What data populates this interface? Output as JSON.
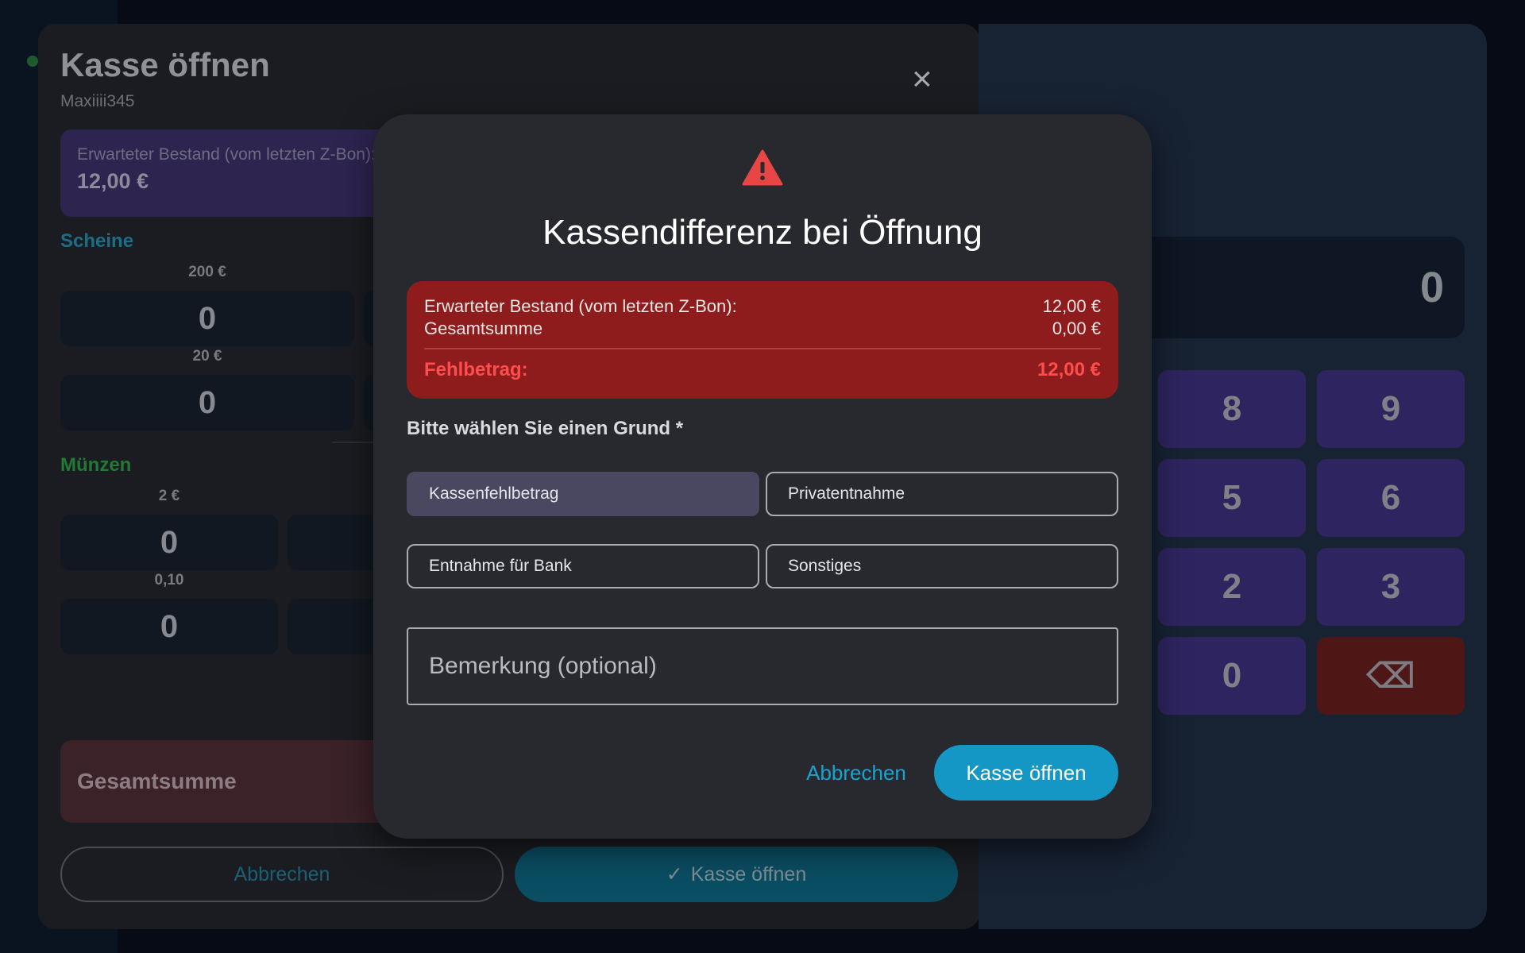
{
  "background": {
    "title": "Kasse öffnen",
    "user": "Maxiiii345",
    "close_icon": "close-icon",
    "expected": {
      "label": "Erwarteter Bestand (vom letzten Z-Bon):",
      "value": "12,00 €"
    },
    "sections": {
      "notes": "Scheine",
      "coins": "Münzen"
    },
    "notes": [
      {
        "label": "200 €",
        "count": "0"
      },
      {
        "label": "20 €",
        "count": "0"
      }
    ],
    "coins": [
      {
        "label": "2 €",
        "count": "0"
      },
      {
        "label": "0,10",
        "count": "0"
      }
    ],
    "total_label": "Gesamtsumme",
    "cancel_label": "Abbrechen",
    "open_label": "Kasse öffnen",
    "check_icon": "check-icon",
    "display_value": "0",
    "keypad": [
      "8",
      "9",
      "5",
      "6",
      "2",
      "3",
      "0",
      "⌫"
    ]
  },
  "modal": {
    "warning_icon": "warning-icon",
    "title": "Kassendifferenz bei Öffnung",
    "summary": {
      "expected_label": "Erwarteter Bestand (vom letzten Z-Bon):",
      "expected_value": "12,00 €",
      "total_label": "Gesamtsumme",
      "total_value": "0,00 €",
      "missing_label": "Fehlbetrag:",
      "missing_value": "12,00 €"
    },
    "reason_label": "Bitte wählen Sie einen Grund *",
    "reasons": [
      {
        "label": "Kassenfehlbetrag",
        "selected": true
      },
      {
        "label": "Privatentnahme",
        "selected": false
      },
      {
        "label": "Entnahme für Bank",
        "selected": false
      },
      {
        "label": "Sonstiges",
        "selected": false
      }
    ],
    "remark_placeholder": "Bemerkung (optional)",
    "remark_value": "",
    "cancel_label": "Abbrechen",
    "open_label": "Kasse öffnen"
  },
  "colors": {
    "accent": "#1497c4",
    "danger": "#8e1c1c",
    "missing_text": "#ff4d4d",
    "selected_option": "#4a4760"
  }
}
